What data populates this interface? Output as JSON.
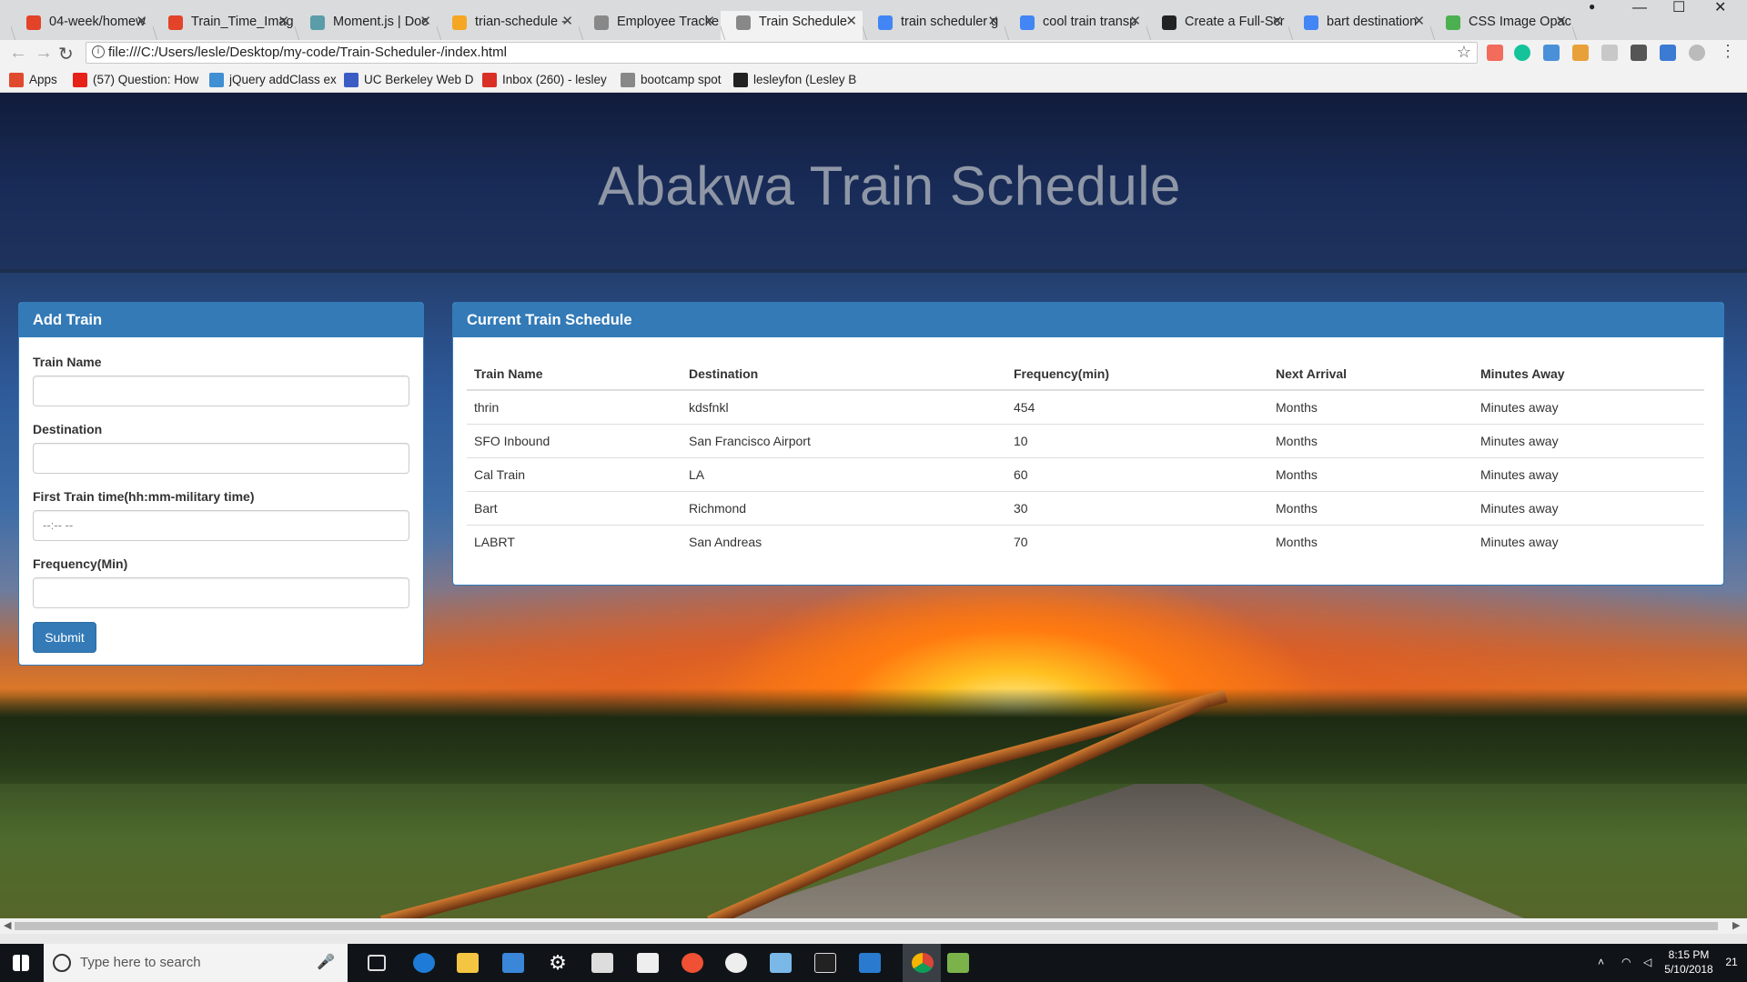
{
  "browser": {
    "tabs": [
      {
        "title": "04-week/homew",
        "favicon_color": "#e24329"
      },
      {
        "title": "Train_Time_Imag",
        "favicon_color": "#e24329"
      },
      {
        "title": "Moment.js | Doc",
        "favicon_color": "#5a9ca8"
      },
      {
        "title": "trian-schedule -",
        "favicon_color": "#f5a623"
      },
      {
        "title": "Employee Tracke",
        "favicon_color": "#888888"
      },
      {
        "title": "Train Schedule",
        "favicon_color": "#888888"
      },
      {
        "title": "train scheduler g",
        "favicon_color": "#4285f4"
      },
      {
        "title": "cool train transp",
        "favicon_color": "#4285f4"
      },
      {
        "title": "Create a Full-Scr",
        "favicon_color": "#222222"
      },
      {
        "title": "bart destination",
        "favicon_color": "#4285f4"
      },
      {
        "title": "CSS Image Opac",
        "favicon_color": "#4caf50"
      }
    ],
    "active_tab_index": 5,
    "url": "file:///C:/Users/lesle/Desktop/my-code/Train-Scheduler-/index.html",
    "bookmarks": [
      {
        "label": "Apps",
        "icon": "apps-grid-icon",
        "color": "#e04a2e"
      },
      {
        "label": "(57) Question: How",
        "icon": "youtube-icon",
        "color": "#e62117"
      },
      {
        "label": "jQuery addClass ex",
        "icon": "cloud-icon",
        "color": "#3f8fd2"
      },
      {
        "label": "UC Berkeley Web D",
        "icon": "document-icon",
        "color": "#3b5cc4"
      },
      {
        "label": "Inbox (260) - lesley",
        "icon": "gmail-icon",
        "color": "#d93025"
      },
      {
        "label": "bootcamp spot",
        "icon": "page-icon",
        "color": "#888888"
      },
      {
        "label": "lesleyfon (Lesley B",
        "icon": "github-icon",
        "color": "#222222"
      }
    ]
  },
  "page": {
    "heading": "Abakwa Train Schedule",
    "add_train": {
      "panel_title": "Add Train",
      "fields": [
        {
          "label": "Train Name",
          "value": "",
          "placeholder": ""
        },
        {
          "label": "Destination",
          "value": "",
          "placeholder": ""
        },
        {
          "label": "First Train time(hh:mm-military time)",
          "value": "",
          "placeholder": "--:-- --"
        },
        {
          "label": "Frequency(Min)",
          "value": "",
          "placeholder": ""
        }
      ],
      "submit_label": "Submit"
    },
    "schedule": {
      "panel_title": "Current Train Schedule",
      "columns": [
        "Train Name",
        "Destination",
        "Frequency(min)",
        "Next Arrival",
        "Minutes Away"
      ],
      "rows": [
        [
          "thrin",
          "kdsfnkl",
          "454",
          "Months",
          "Minutes away"
        ],
        [
          "SFO Inbound",
          "San Francisco Airport",
          "10",
          "Months",
          "Minutes away"
        ],
        [
          "Cal Train",
          "LA",
          "60",
          "Months",
          "Minutes away"
        ],
        [
          "Bart",
          "Richmond",
          "30",
          "Months",
          "Minutes away"
        ],
        [
          "LABRT",
          "San Andreas",
          "70",
          "Months",
          "Minutes away"
        ]
      ]
    },
    "accent_color": "#337ab7"
  },
  "taskbar": {
    "search_placeholder": "Type here to search",
    "time": "8:15 PM",
    "date": "5/10/2018",
    "notification_count": "21"
  }
}
